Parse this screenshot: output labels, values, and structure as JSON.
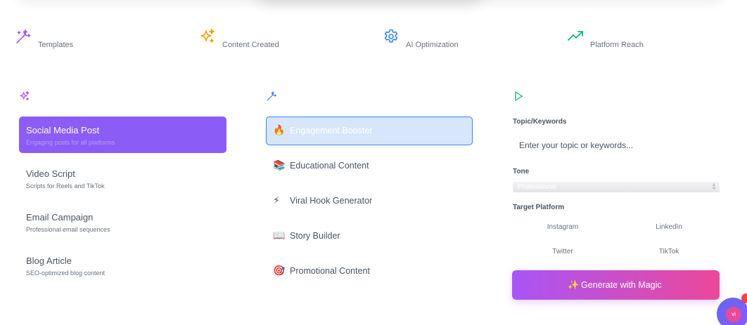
{
  "stats": [
    {
      "label": "Templates",
      "icon": "magic-wand-icon",
      "color": "#a855f7"
    },
    {
      "label": "Content Created",
      "icon": "sparkles-icon",
      "color": "#f59e0b"
    },
    {
      "label": "AI Optimization",
      "icon": "gear-icon",
      "color": "#3b82f6"
    },
    {
      "label": "Platform Reach",
      "icon": "trending-up-icon",
      "color": "#10b981"
    }
  ],
  "content_types": [
    {
      "title": "Social Media Post",
      "subtitle": "Engaging posts for all platforms",
      "active": true
    },
    {
      "title": "Video Script",
      "subtitle": "Scripts for Reels and TikTok",
      "active": false
    },
    {
      "title": "Email Campaign",
      "subtitle": "Professional email sequences",
      "active": false
    },
    {
      "title": "Blog Article",
      "subtitle": "SEO-optimized blog content",
      "active": false
    }
  ],
  "styles": [
    {
      "emoji": "🔥",
      "label": "Engagement Booster",
      "active": true
    },
    {
      "emoji": "📚",
      "label": "Educational Content",
      "active": false
    },
    {
      "emoji": "⚡",
      "label": "Viral Hook Generator",
      "active": false
    },
    {
      "emoji": "📖",
      "label": "Story Builder",
      "active": false
    },
    {
      "emoji": "🎯",
      "label": "Promotional Content",
      "active": false
    }
  ],
  "form": {
    "topic_label": "Topic/Keywords",
    "topic_placeholder": "Enter your topic or keywords...",
    "tone_label": "Tone",
    "tone_value": "Professional",
    "platform_label": "Target Platform",
    "platforms": [
      "Instagram",
      "LinkedIn",
      "Twitter",
      "TikTok"
    ],
    "generate_icon": "✨",
    "generate_label": "Generate with Magic"
  },
  "avatar": {
    "initials": "vi"
  },
  "colors": {
    "accent_purple": "#8b5cf6",
    "active_blue_border": "#3b82f6",
    "gradient_start": "#a855f7",
    "gradient_end": "#ec4899"
  }
}
